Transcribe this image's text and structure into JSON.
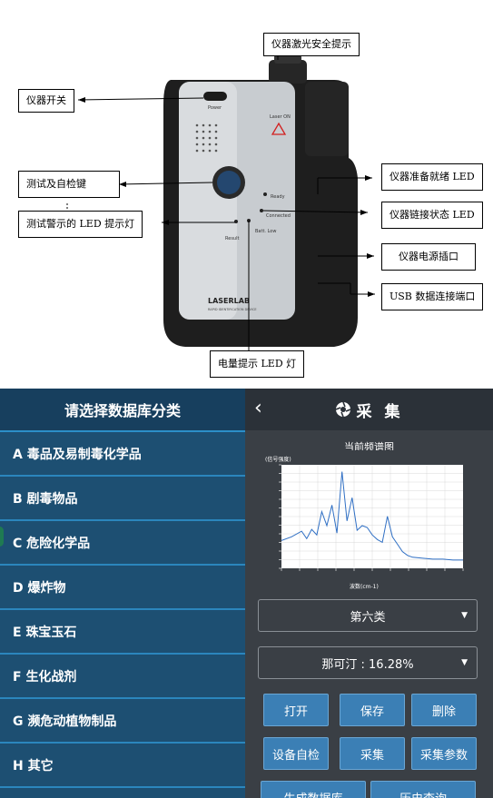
{
  "diagram": {
    "device_labels": {
      "power": "Power",
      "laser_on": "Laser ON",
      "ready": "Ready",
      "connected": "Connected",
      "battery": "Batt. Low",
      "result": "Result",
      "brand": "LASERLAB",
      "brand_sub": "RAPID IDENTIFICATION DEVICE"
    },
    "callouts": {
      "laser_safety": "仪器激光安全提示",
      "power_switch": "仪器开关",
      "test_self_check": "测试及自检键",
      "test_warning_led": "测试警示的 LED 提示灯",
      "ready_led": "仪器准备就绪 LED",
      "link_led": "仪器链接状态 LED",
      "power_port": "仪器电源插口",
      "usb_port": "USB 数据连接端口",
      "battery_led": "电量提示 LED 灯"
    }
  },
  "left_panel": {
    "header": "请选择数据库分类",
    "categories": [
      "A 毒品及易制毒化学品",
      "B 剧毒物品",
      "C 危险化学品",
      "D 爆炸物",
      "E 珠宝玉石",
      "F 生化战剂",
      "G 濒危动植物制品",
      "H 其它"
    ]
  },
  "right_panel": {
    "title": "采 集",
    "spectrum_title": "当前频谱图",
    "y_axis_label": "(信号强度)",
    "x_axis_label": "波数(cm-1)",
    "class_select": "第六类",
    "result_select": "那可汀 : 16.28%",
    "buttons": {
      "open": "打开",
      "save": "保存",
      "delete": "删除",
      "self_check": "设备自检",
      "collect": "采集",
      "collect_params": "采集参数",
      "generate_db": "生成数据库",
      "history": "历史查询"
    }
  },
  "chart_data": {
    "type": "line",
    "title": "当前频谱图",
    "xlabel": "波数(cm-1)",
    "ylabel": "(信号强度)",
    "series": [
      {
        "x": [
          200,
          300,
          400,
          450,
          500,
          550,
          600,
          650,
          700,
          750,
          800,
          850,
          900,
          950,
          1000,
          1050,
          1100,
          1150,
          1200,
          1250,
          1300,
          1350,
          1400,
          1450,
          1500,
          1600,
          1700,
          1800,
          1900,
          2000
        ],
        "y": [
          0.24,
          0.28,
          0.34,
          0.26,
          0.36,
          0.3,
          0.55,
          0.4,
          0.62,
          0.32,
          0.98,
          0.45,
          0.7,
          0.35,
          0.4,
          0.38,
          0.3,
          0.25,
          0.22,
          0.5,
          0.28,
          0.2,
          0.12,
          0.08,
          0.06,
          0.05,
          0.04,
          0.04,
          0.03,
          0.03
        ]
      }
    ],
    "grid": true
  }
}
